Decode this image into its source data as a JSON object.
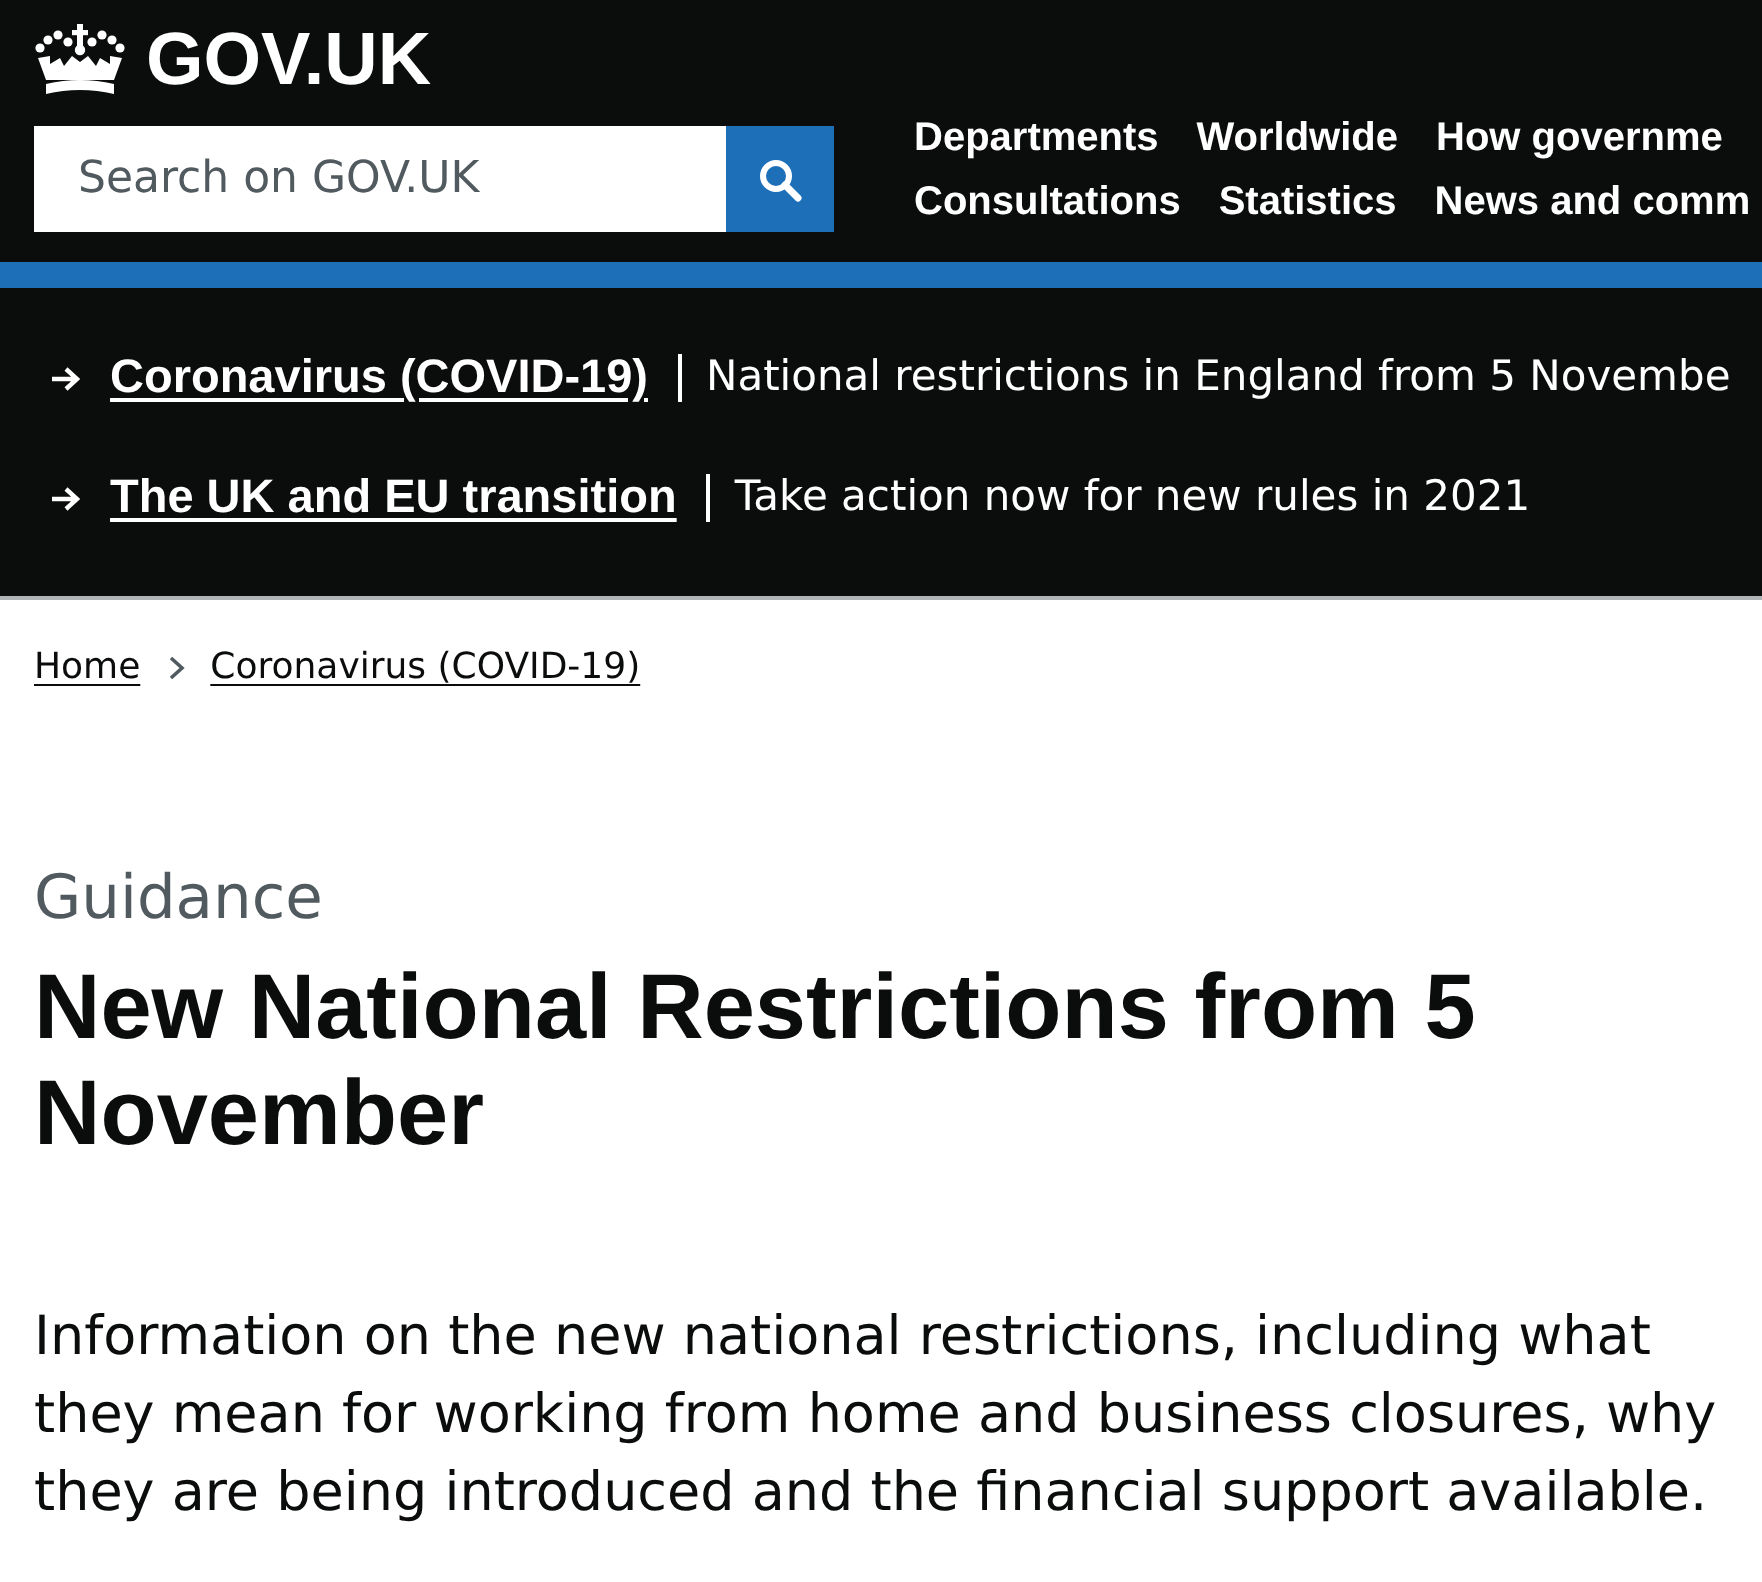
{
  "header": {
    "logo": "GOV.UK",
    "search": {
      "placeholder": "Search on GOV.UK"
    },
    "nav": [
      [
        "Departments",
        "Worldwide",
        "How governme"
      ],
      [
        "Consultations",
        "Statistics",
        "News and comm"
      ]
    ]
  },
  "announcements": [
    {
      "link": "Coronavirus (COVID-19)",
      "text": "National restrictions in England from 5 Novembe"
    },
    {
      "link": "The UK and EU transition",
      "text": "Take action now for new rules in 2021"
    }
  ],
  "breadcrumbs": [
    "Home",
    "Coronavirus (COVID-19)"
  ],
  "page": {
    "caption": "Guidance",
    "title": "New National Restrictions from 5 November",
    "lead": "Information on the new national restrictions, including what they mean for working from home and business closures, why they are being introduced and the financial support available."
  }
}
